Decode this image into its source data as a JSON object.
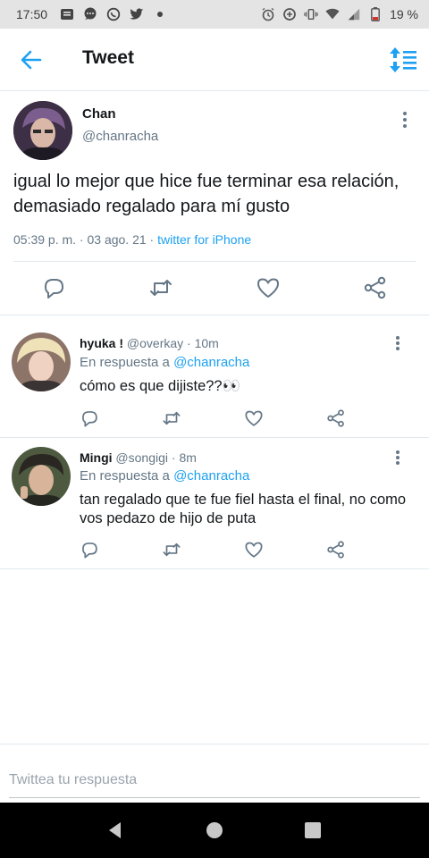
{
  "status_bar": {
    "time": "17:50",
    "battery": "19 %",
    "left_icons": [
      "message-icon",
      "chat-icon",
      "whatsapp-icon",
      "twitter-icon",
      "dot-icon"
    ],
    "right_icons": [
      "alarm-icon",
      "data-saver-icon",
      "vibrate-icon",
      "wifi-icon",
      "signal-icon",
      "battery-icon"
    ]
  },
  "header": {
    "title": "Tweet",
    "accent": "#1da1f2"
  },
  "main_tweet": {
    "name": "Chan",
    "handle": "@chanracha",
    "text": "igual lo mejor que hice fue terminar esa relación, demasiado regalado para mí gusto",
    "timestamp": "05:39 p. m. · 03 ago. 21 · ",
    "source": "twitter for iPhone"
  },
  "replies": [
    {
      "name": "hyuka !",
      "handle_time": " @overkay · 10m",
      "in_reply_label": "En respuesta a ",
      "in_reply_mention": "@chanracha",
      "text": "cómo es que dijiste??👀"
    },
    {
      "name": "Mingi",
      "handle_time": " @songigi · 8m",
      "in_reply_label": "En respuesta a ",
      "in_reply_mention": "@chanracha",
      "text": "tan regalado que te fue fiel hasta el final, no como vos pedazo de hijo de puta"
    }
  ],
  "compose": {
    "placeholder": "Twittea tu respuesta"
  }
}
